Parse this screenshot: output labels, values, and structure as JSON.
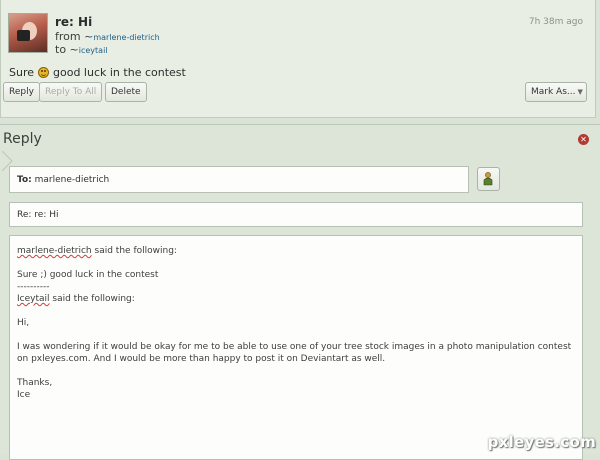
{
  "message": {
    "title": "re: Hi",
    "from_label": "from",
    "from_user": "marlene-dietrich",
    "to_label": "to",
    "to_user": "iceytail",
    "timestamp": "7h 38m ago",
    "body_before": "Sure",
    "smiley": "smiley-icon",
    "body_after": "good luck in the contest",
    "buttons": {
      "reply": "Reply",
      "reply_all": "Reply To All",
      "delete": "Delete",
      "mark_as": "Mark As..."
    }
  },
  "reply": {
    "heading": "Reply",
    "to_label": "To:",
    "to_value": "marlene-dietrich",
    "subject": "Re: re: Hi",
    "body": {
      "quote_author": "marlene-dietrich",
      "quote_said": "said the following:",
      "quote_text": "Sure ;) good luck in the contest",
      "divider": "----------",
      "author2": "Iceytail",
      "author2_said": "said the following:",
      "greeting": "Hi,",
      "paragraph": "I was wondering if it would be okay for me to be able to use one of your tree stock images in a photo manipulation contest on pxleyes.com. And I would be more than happy to post it on Deviantart as well.",
      "signoff": "Thanks,",
      "signature": "Ice"
    }
  },
  "watermark": "pxleyes.com",
  "colors": {
    "link": "#1f5f86",
    "close": "#b23a32",
    "spellcheck": "#d23b3b"
  }
}
